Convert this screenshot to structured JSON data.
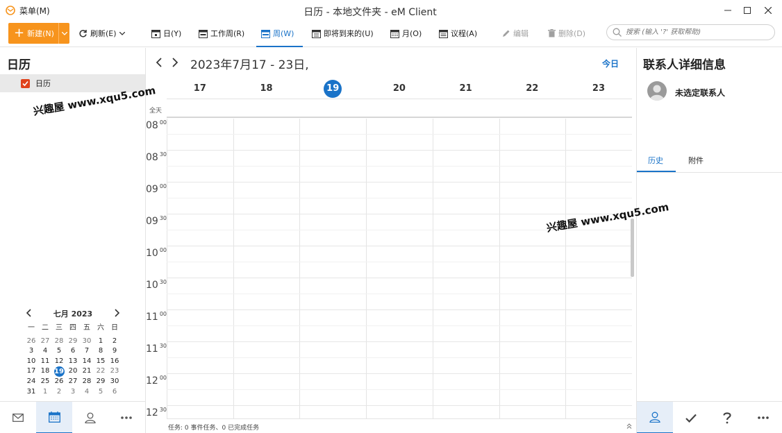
{
  "titlebar": {
    "menu_label": "菜单(M)",
    "title": "日历 - 本地文件夹 - eM Client"
  },
  "toolbar": {
    "new_label": "新建(N)",
    "refresh_label": "刷新(E)",
    "views": [
      {
        "label": "日(Y)",
        "icon": "day-icon"
      },
      {
        "label": "工作周(R)",
        "icon": "workweek-icon"
      },
      {
        "label": "周(W)",
        "icon": "week-icon",
        "active": true
      },
      {
        "label": "即将到来的(U)",
        "icon": "upcoming-icon"
      },
      {
        "label": "月(O)",
        "icon": "month-icon"
      },
      {
        "label": "议程(A)",
        "icon": "agenda-icon"
      }
    ],
    "edit_label": "编辑",
    "delete_label": "删除(D)",
    "search_placeholder": "搜索 (输入 '?' 获取帮助)",
    "accent_color": "#f7941d",
    "active_color": "#1a73c8"
  },
  "left": {
    "title": "日历",
    "calendar_item": "日历",
    "mini_calendar": {
      "month_label": "七月 2023",
      "weekdays": [
        "一",
        "二",
        "三",
        "四",
        "五",
        "六",
        "日"
      ],
      "weeks": [
        [
          "26",
          "27",
          "28",
          "29",
          "30",
          "1",
          "2"
        ],
        [
          "3",
          "4",
          "5",
          "6",
          "7",
          "8",
          "9"
        ],
        [
          "10",
          "11",
          "12",
          "13",
          "14",
          "15",
          "16"
        ],
        [
          "17",
          "18",
          "19",
          "20",
          "21",
          "22",
          "23"
        ],
        [
          "24",
          "25",
          "26",
          "27",
          "28",
          "29",
          "30"
        ],
        [
          "31",
          "1",
          "2",
          "3",
          "4",
          "5",
          "6"
        ]
      ],
      "today": "19"
    }
  },
  "main": {
    "range_title": "2023年7月17 - 23日,",
    "today_label": "今日",
    "days": [
      "17",
      "18",
      "19",
      "20",
      "21",
      "22",
      "23"
    ],
    "today_day": "19",
    "allday_label": "全天",
    "hours": [
      {
        "h": "08",
        "m": "00"
      },
      {
        "h": "08",
        "m": "30"
      },
      {
        "h": "09",
        "m": "00"
      },
      {
        "h": "09",
        "m": "30"
      },
      {
        "h": "10",
        "m": "00"
      },
      {
        "h": "10",
        "m": "30"
      },
      {
        "h": "11",
        "m": "00"
      },
      {
        "h": "11",
        "m": "30"
      },
      {
        "h": "12",
        "m": "00"
      },
      {
        "h": "12",
        "m": "30"
      }
    ],
    "status_text": "任务: 0 事件任务、0 已完成任务"
  },
  "right": {
    "title": "联系人详细信息",
    "contact_name": "未选定联系人",
    "tabs": [
      "历史",
      "附件"
    ]
  },
  "watermarks": [
    "兴趣屋 www.xqu5.com",
    "兴趣屋 www.xqu5.com"
  ]
}
